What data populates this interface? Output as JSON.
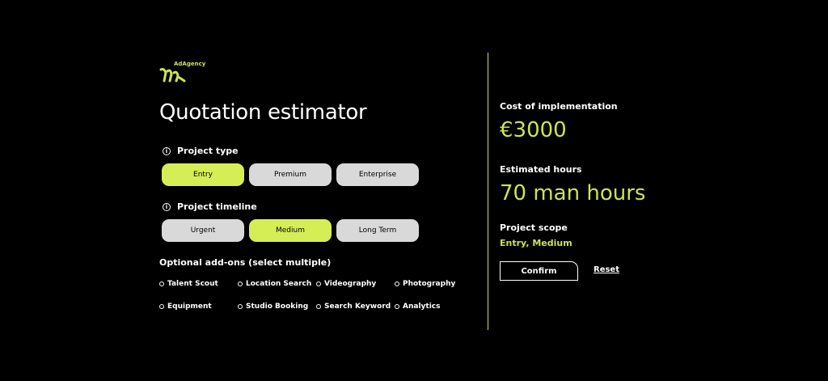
{
  "brand": {
    "name": "AdAgency",
    "logo_icon": "brand-stripes-icon",
    "accent": "#cde352"
  },
  "title": "Quotation estimator",
  "project_type": {
    "label": "Project type",
    "options": [
      "Entry",
      "Premium",
      "Enterprise"
    ],
    "selected": "Entry"
  },
  "project_timeline": {
    "label": "Project timeline",
    "options": [
      "Urgent",
      "Medium",
      "Long Term"
    ],
    "selected": "Medium"
  },
  "addons": {
    "label": "Optional add-ons (select multiple)",
    "items": [
      "Talent Scout",
      "Location Search",
      "Videography",
      "Photography",
      "Equipment",
      "Studio Booking",
      "Search Keyword",
      "Analytics"
    ]
  },
  "summary": {
    "cost_label": "Cost of implementation",
    "cost_value": "€3000",
    "hours_label": "Estimated hours",
    "hours_value": "70 man hours",
    "scope_label": "Project scope",
    "scope_value": "Entry, Medium"
  },
  "actions": {
    "confirm": "Confirm",
    "reset": "Reset"
  },
  "colors": {
    "background": "#000000",
    "active_option": "#d6ee55",
    "inactive_option": "#d9d9d9"
  }
}
